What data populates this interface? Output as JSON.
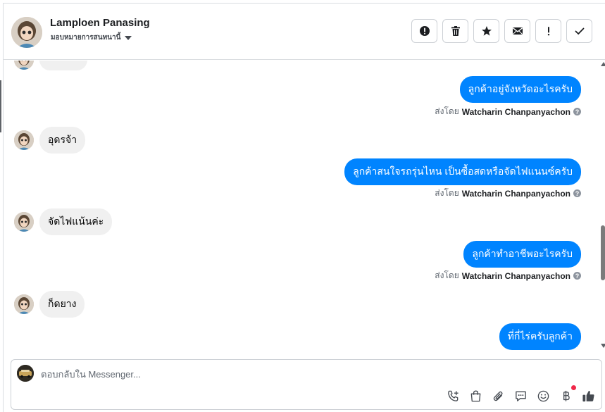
{
  "header": {
    "contact_name": "Lamploen Panasing",
    "assign_label": "มอบหมายการสนทนานี้",
    "actions": [
      {
        "id": "spam",
        "icon": "alert-circle-icon"
      },
      {
        "id": "delete",
        "icon": "trash-icon"
      },
      {
        "id": "star",
        "icon": "star-icon"
      },
      {
        "id": "unread",
        "icon": "envelope-icon"
      },
      {
        "id": "follow-up",
        "icon": "exclamation-icon"
      },
      {
        "id": "done",
        "icon": "check-icon"
      }
    ]
  },
  "conversation": {
    "messages": [
      {
        "dir": "in",
        "text": ""
      },
      {
        "dir": "out",
        "text": "ลูกค้าอยู่จังหวัดอะไรครับ",
        "sent_by_prefix": "ส่งโดย",
        "sent_by": "Watcharin Chanpanyachon"
      },
      {
        "dir": "in",
        "text": "อุดรจ้า"
      },
      {
        "dir": "out",
        "text": "ลูกค้าสนใจรถรุ่นไหน เป็นซื้อสดหรือจัดไฟแนนซ์ครับ",
        "sent_by_prefix": "ส่งโดย",
        "sent_by": "Watcharin Chanpanyachon"
      },
      {
        "dir": "in",
        "text": "จัดไฟแน้นค่ะ"
      },
      {
        "dir": "out",
        "text": "ลูกค้าทำอาชีพอะไรครับ",
        "sent_by_prefix": "ส่งโดย",
        "sent_by": "Watcharin Chanpanyachon"
      },
      {
        "dir": "in",
        "text": "ก็ดยาง"
      },
      {
        "dir": "out",
        "text": "ที่กี่ไร่ครับลูกค้า"
      }
    ]
  },
  "composer": {
    "placeholder": "ตอบกลับใน Messenger...",
    "tools": [
      "phone-plus-icon",
      "shopping-bag-icon",
      "paperclip-icon",
      "saved-reply-icon",
      "emoji-icon",
      "baht-payment-icon",
      "like-icon"
    ]
  },
  "colors": {
    "outgoing_bubble": "#0084ff",
    "incoming_bubble": "#f0f0f0",
    "notification_dot": "#f02849"
  }
}
